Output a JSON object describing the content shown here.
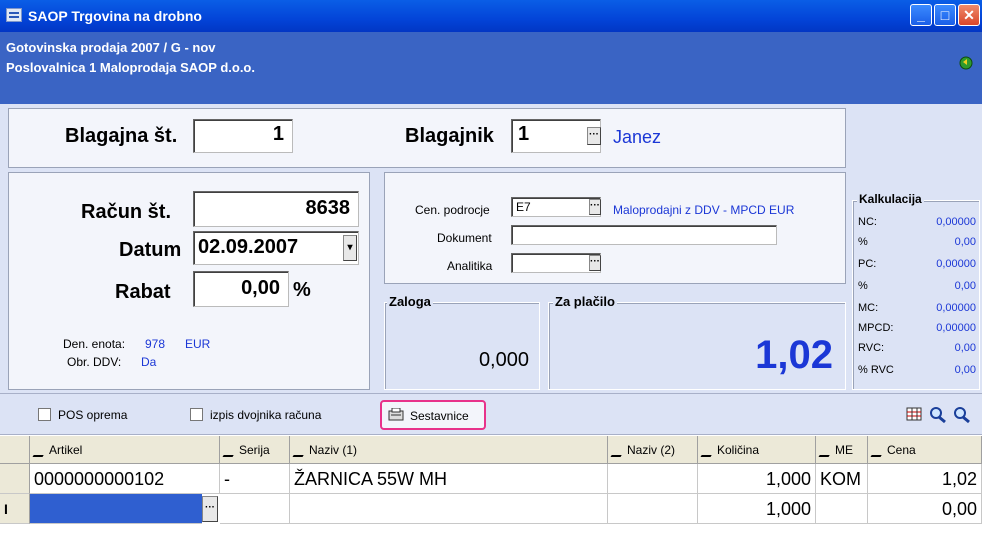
{
  "window": {
    "title": "SAOP Trgovina na drobno",
    "subtitle1": "Gotovinska prodaja 2007 / G - nov",
    "subtitle2": "Poslovalnica 1 Maloprodaja SAOP d.o.o."
  },
  "header": {
    "blagajna_label": "Blagajna št.",
    "blagajna_value": "1",
    "blagajnik_label": "Blagajnik",
    "blagajnik_value": "1",
    "blagajnik_name": "Janez"
  },
  "invoice": {
    "racun_label": "Račun št.",
    "racun_value": "8638",
    "datum_label": "Datum",
    "datum_value": "02.09.2007",
    "rabat_label": "Rabat",
    "rabat_value": "0,00",
    "rabat_unit": "%",
    "den_enota_label": "Den. enota:",
    "den_enota_code": "978",
    "den_enota_value": "EUR",
    "obr_ddv_label": "Obr. DDV:",
    "obr_ddv_value": "Da"
  },
  "pricing": {
    "cen_label": "Cen. podrocje",
    "cen_value": "E7",
    "cen_desc": "Maloprodajni z DDV - MPCD EUR",
    "dokument_label": "Dokument",
    "dokument_value": "",
    "analitika_label": "Analitika",
    "analitika_value": ""
  },
  "totals": {
    "zaloga_label": "Zaloga",
    "zaloga_value": "0,000",
    "zaplacilo_label": "Za plačilo",
    "zaplacilo_value": "1,02"
  },
  "kalkulacija": {
    "title": "Kalkulacija",
    "rows": [
      {
        "label": "NC:",
        "value": "0,00000"
      },
      {
        "label": "%",
        "value": "0,00"
      },
      {
        "label": "PC:",
        "value": "0,00000"
      },
      {
        "label": "%",
        "value": "0,00"
      },
      {
        "label": "MC:",
        "value": "0,00000"
      },
      {
        "label": "MPCD:",
        "value": "0,00000"
      },
      {
        "label": "RVC:",
        "value": "0,00"
      },
      {
        "label": "% RVC",
        "value": "0,00"
      }
    ]
  },
  "toolbar": {
    "pos_label": "POS oprema",
    "izpis_label": "izpis dvojnika računa",
    "sestavnice_label": "Sestavnice"
  },
  "grid": {
    "columns": [
      "Artikel",
      "Serija",
      "Naziv (1)",
      "Naziv (2)",
      "Količina",
      "ME",
      "Cena"
    ],
    "row1": {
      "artikel": "0000000000102",
      "serija": "-",
      "naziv1": "ŽARNICA 55W MH",
      "naziv2": "",
      "kolicina": "1,000",
      "me": "KOM",
      "cena": "1,02"
    },
    "row2": {
      "artikel": "",
      "serija": "",
      "naziv1": "",
      "naziv2": "",
      "kolicina": "1,000",
      "me": "",
      "cena": "0,00"
    },
    "row_marker": "I"
  }
}
